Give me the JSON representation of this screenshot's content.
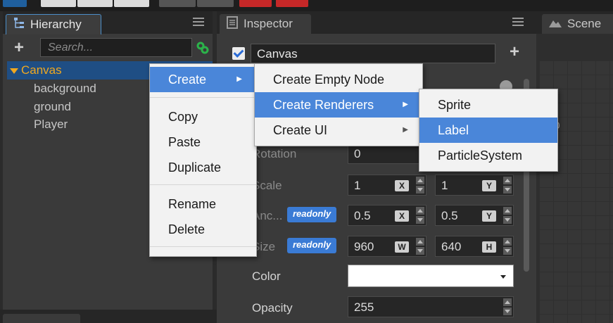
{
  "panels": {
    "hierarchy": {
      "title": "Hierarchy"
    },
    "inspector": {
      "title": "Inspector"
    },
    "scene": {
      "title": "Scene"
    }
  },
  "hierarchy": {
    "search_placeholder": "Search...",
    "root": "Canvas",
    "children": [
      "background",
      "ground",
      "Player"
    ]
  },
  "inspector": {
    "node_name": "Canvas",
    "props": {
      "rotation": {
        "label": "Rotation",
        "value": "0"
      },
      "scale": {
        "label": "Scale",
        "x": "1",
        "y": "1"
      },
      "anchor": {
        "label": "Anc...",
        "badge": "readonly",
        "x": "0.5",
        "y": "0.5"
      },
      "size": {
        "label": "Size",
        "badge": "readonly",
        "w": "960",
        "h": "640"
      },
      "color": {
        "label": "Color",
        "value": "#ffffff"
      },
      "opacity": {
        "label": "Opacity",
        "value": "255"
      }
    },
    "axis": {
      "x": "X",
      "y": "Y",
      "w": "W",
      "h": "H"
    }
  },
  "scene": {
    "coord_fragment": "00"
  },
  "context_menu": {
    "create": "Create",
    "copy": "Copy",
    "paste": "Paste",
    "duplicate": "Duplicate",
    "rename": "Rename",
    "delete": "Delete"
  },
  "create_menu": {
    "empty_node": "Create Empty Node",
    "renderers": "Create Renderers",
    "ui": "Create UI"
  },
  "renderers_menu": {
    "sprite": "Sprite",
    "label": "Label",
    "particle": "ParticleSystem"
  },
  "colors": {
    "accent": "#4a86d9",
    "selection": "#1f4e84",
    "root_node": "#f0a820",
    "link_icon": "#2bb34a"
  }
}
